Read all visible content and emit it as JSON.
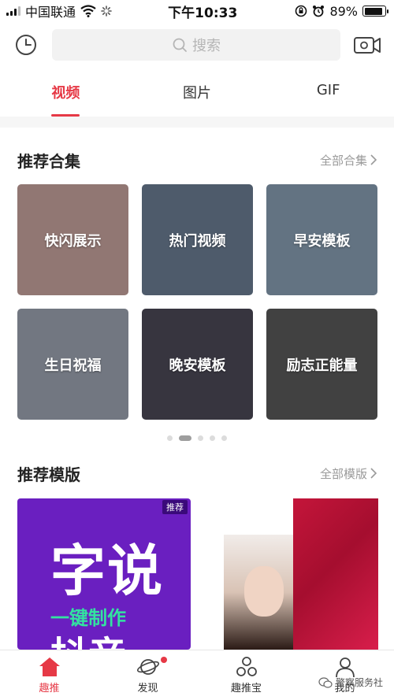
{
  "status_bar": {
    "carrier": "中国联通",
    "time": "下午10:33",
    "battery": "89%",
    "battery_level": 0.89
  },
  "header": {
    "search_placeholder": "搜索",
    "history_icon": "clock-icon",
    "camera_icon": "video-camera-icon"
  },
  "tabs": [
    {
      "label": "视频",
      "active": true
    },
    {
      "label": "图片",
      "active": false
    },
    {
      "label": "GIF",
      "active": false
    }
  ],
  "collections": {
    "title": "推荐合集",
    "more": "全部合集",
    "items": [
      {
        "label": "快闪展示",
        "color": "#c9a5a0"
      },
      {
        "label": "热门视频",
        "color": "#6d7f95"
      },
      {
        "label": "早安模板",
        "color": "#8aa0b4"
      },
      {
        "label": "生日祝福",
        "color": "#9fa6b3"
      },
      {
        "label": "晚安模板",
        "color": "#4d4a58"
      },
      {
        "label": "励志正能量",
        "color": "#5a5a5a"
      }
    ],
    "pages": 5,
    "active_page": 2
  },
  "templates": {
    "title": "推荐模版",
    "more": "全部模版",
    "badge": "推荐",
    "poster_big_text": "字说",
    "poster_sub_text": "一键制作",
    "poster_bottom_text": "抖音"
  },
  "bottom_nav": [
    {
      "label": "趣推",
      "icon": "home-icon",
      "active": true
    },
    {
      "label": "发现",
      "icon": "planet-icon",
      "active": false
    },
    {
      "label": "趣推宝",
      "icon": "molecule-icon",
      "active": false
    },
    {
      "label": "我的",
      "icon": "person-icon",
      "active": false
    }
  ],
  "watermark": "警察服务社",
  "colors": {
    "accent": "#e63946",
    "poster_bg": "#6a1fc0",
    "poster_green": "#33e3a0"
  }
}
